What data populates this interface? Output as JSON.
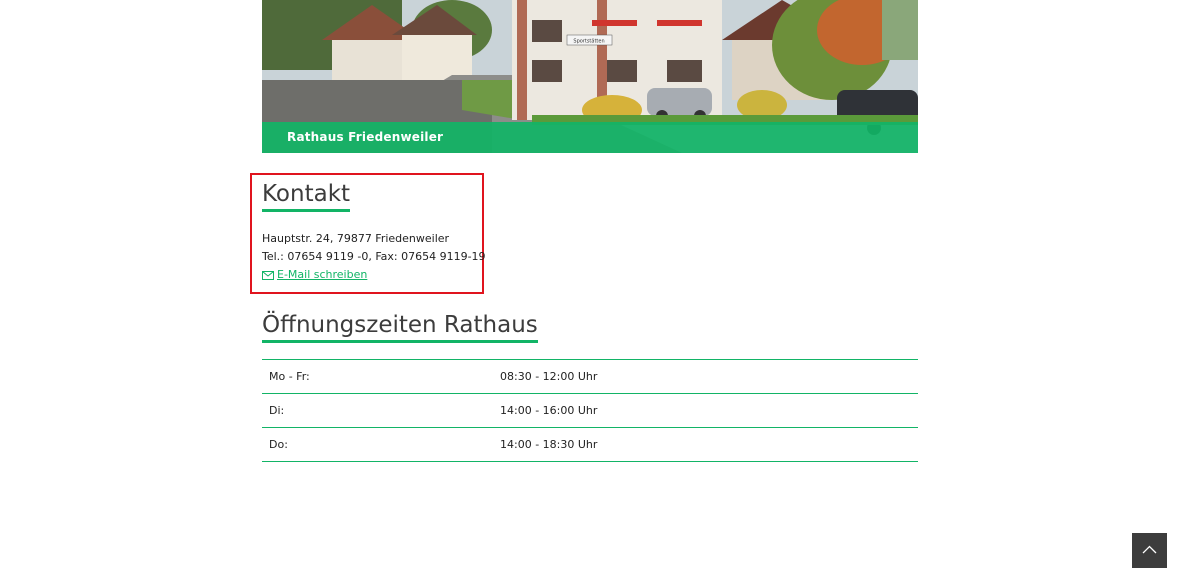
{
  "hero": {
    "caption": "Rathaus Friedenweiler",
    "sign_text": "Sportstätten"
  },
  "kontakt": {
    "heading": "Kontakt",
    "address": "Hauptstr. 24, 79877 Friedenweiler",
    "phone_fax": "Tel.: 07654 9119 -0, Fax: 07654 9119-19",
    "email_link": "E-Mail schreiben",
    "email_icon": "envelope-icon"
  },
  "hours": {
    "heading": "Öffnungszeiten Rathaus",
    "rows": [
      {
        "day": "Mo - Fr:",
        "time": "08:30 - 12:00 Uhr"
      },
      {
        "day": "Di:",
        "time": "14:00 - 16:00 Uhr"
      },
      {
        "day": "Do:",
        "time": "14:00 - 18:30 Uhr"
      }
    ]
  },
  "scroll_top": {
    "icon": "chevron-up-icon"
  },
  "colors": {
    "accent": "#12b466",
    "highlight_border": "#e0141e",
    "scroll_button": "#3d3d3d"
  }
}
